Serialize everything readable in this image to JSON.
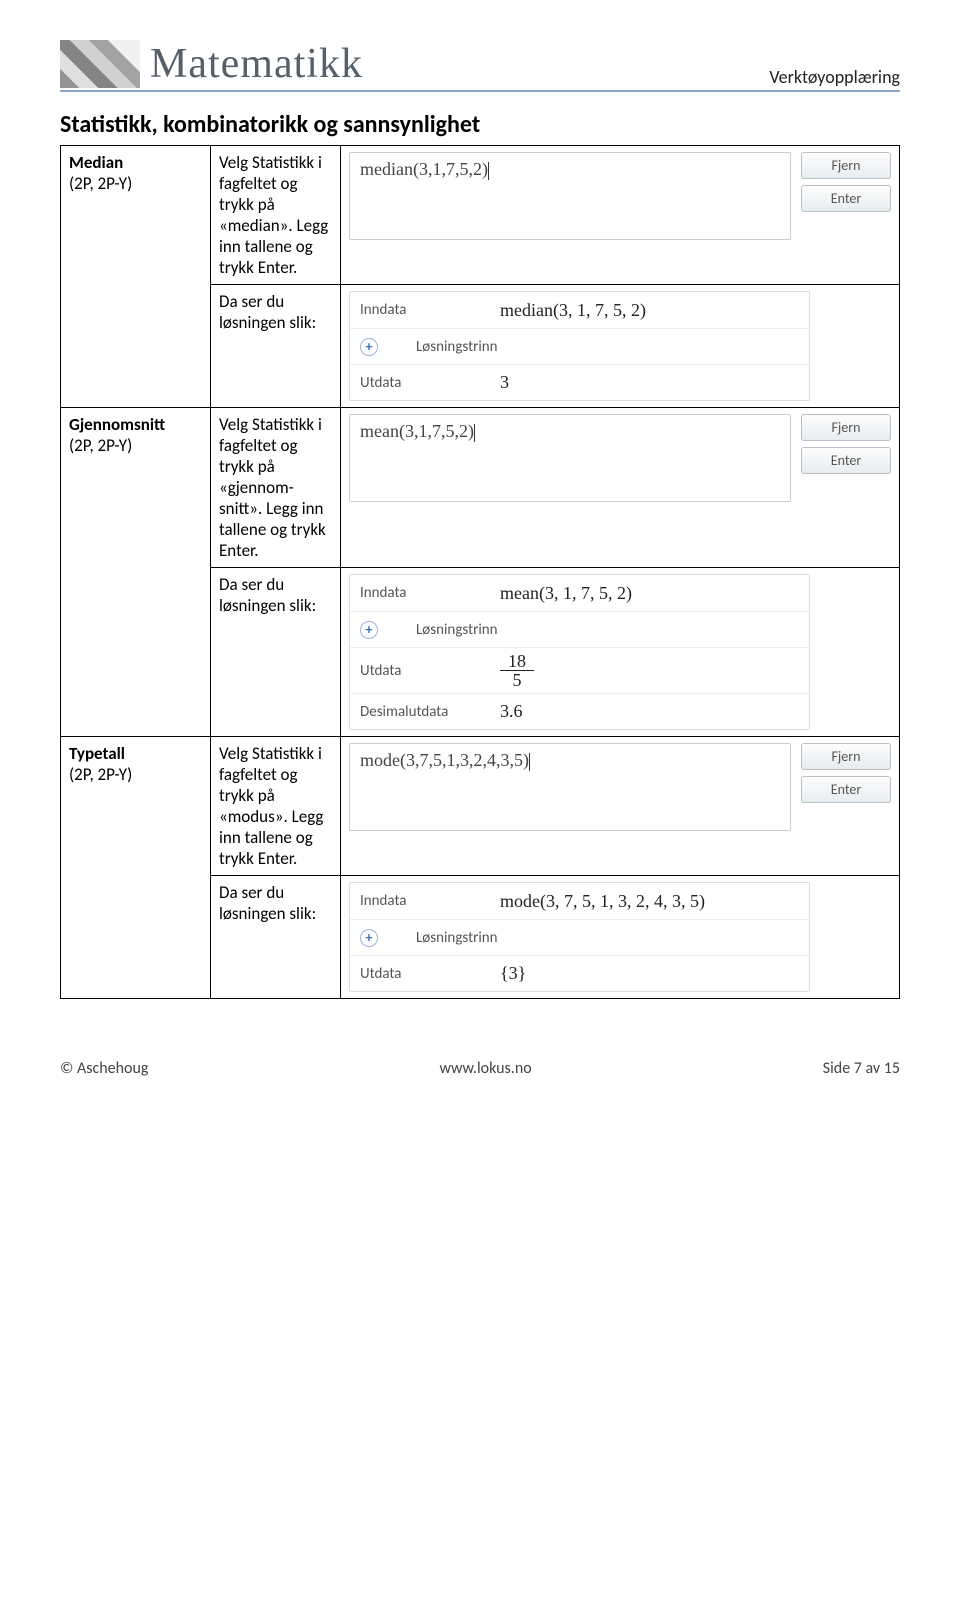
{
  "header": {
    "brand": "Matematikk",
    "section": "Verktøyopplæring"
  },
  "title": "Statistikk, kombinatorikk og sannsynlighet",
  "rows": {
    "median": {
      "name": "Median",
      "scope": "(2P, 2P-Y)",
      "instr1": "Velg Statistikk i fagfeltet og trykk på «median». Legg inn tallene og trykk Enter.",
      "instr2": "Da ser du løsningen slik:",
      "input": "median(3,1,7,5,2)",
      "inndata": "median(3, 1, 7, 5, 2)",
      "utdata": "3"
    },
    "mean": {
      "name": "Gjennomsnitt",
      "scope": "(2P, 2P-Y)",
      "instr1": "Velg Statistikk i fagfeltet og trykk på «gjennom-snitt». Legg inn tallene og trykk Enter.",
      "instr2": "Da ser du løsningen slik:",
      "input": "mean(3,1,7,5,2)",
      "inndata": "mean(3, 1, 7, 5, 2)",
      "frac_n": "18",
      "frac_d": "5",
      "dec": "3.6"
    },
    "mode": {
      "name": "Typetall",
      "scope": "(2P, 2P-Y)",
      "instr1": "Velg Statistikk i fagfeltet og trykk på «modus». Legg inn tallene og trykk Enter.",
      "instr2": "Da ser du løsningen slik:",
      "input": "mode(3,7,5,1,3,2,4,3,5)",
      "inndata": "mode(3, 7, 5, 1, 3, 2, 4, 3, 5)",
      "utdata": "{3}"
    }
  },
  "labels": {
    "inndata": "Inndata",
    "utdata": "Utdata",
    "desimal": "Desimalutdata",
    "losning": "Løsningstrinn",
    "fjern": "Fjern",
    "enter": "Enter"
  },
  "footer": {
    "left": "© Aschehoug",
    "mid": "www.lokus.no",
    "right": "Side 7 av 15"
  }
}
